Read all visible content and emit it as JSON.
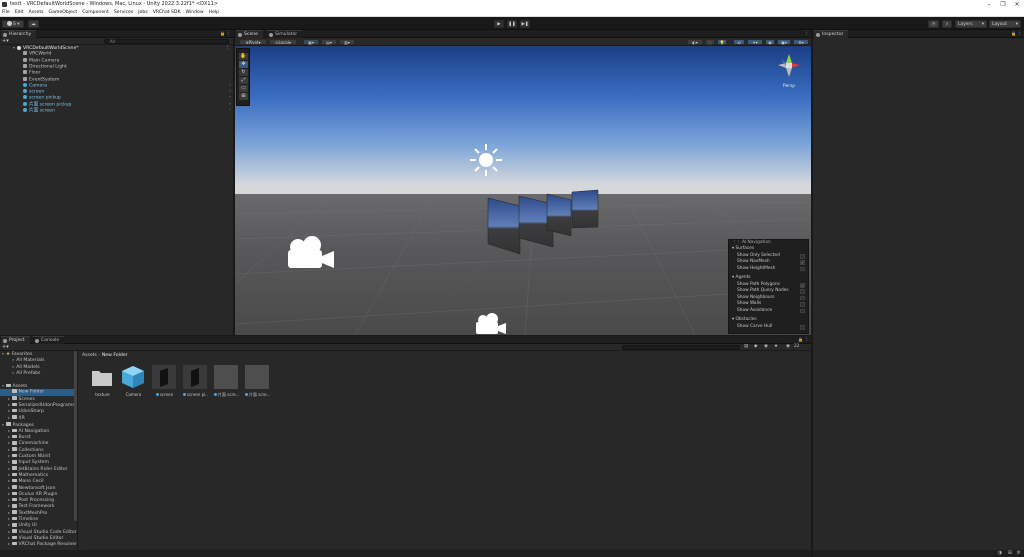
{
  "window": {
    "title": "testt - VRCDefaultWorldScene - Windows, Mac, Linux - Unity 2022.3.22f1* <DX11>",
    "controls": [
      "–",
      "❐",
      "✕"
    ]
  },
  "menu": [
    "File",
    "Edit",
    "Assets",
    "GameObject",
    "Component",
    "Services",
    "Jobs",
    "VRChat SDK",
    "Window",
    "Help"
  ],
  "toolbar": {
    "account_initial": "S",
    "play": "▶",
    "pause": "❚❚",
    "step": "▶❚",
    "layers_label": "Layers",
    "layout_label": "Layout"
  },
  "hierarchy": {
    "tab_label": "Hierarchy",
    "search_placeholder": "All",
    "scene_name": "VRCDefaultWorldScene*",
    "items": [
      {
        "label": "VRCWorld",
        "kind": "gray"
      },
      {
        "label": "Main Camera",
        "kind": "gray"
      },
      {
        "label": "Directional Light",
        "kind": "gray"
      },
      {
        "label": "Floor",
        "kind": "gray"
      },
      {
        "label": "EventSystem",
        "kind": "gray"
      },
      {
        "label": "Camera",
        "kind": "cyan"
      },
      {
        "label": "screen",
        "kind": "cyan"
      },
      {
        "label": "screen pickup",
        "kind": "cyan"
      },
      {
        "label": "片面 screen pickup",
        "kind": "cyan"
      },
      {
        "label": "片面 screen",
        "kind": "cyan"
      }
    ]
  },
  "scene": {
    "tabs": [
      "Scene",
      "Simulator"
    ],
    "pivot_label": "Pivot",
    "local_label": "Local",
    "view_label": "Persp",
    "tools": [
      "hand",
      "move",
      "rotate",
      "scale",
      "rect",
      "transform"
    ]
  },
  "navigation_overlay": {
    "title": "AI Navigation",
    "surfaces_header": "Surfaces",
    "surfaces": [
      {
        "label": "Show Only Selected",
        "checked": false
      },
      {
        "label": "Show NavMesh",
        "checked": true
      },
      {
        "label": "Show HeightMesh",
        "checked": false
      }
    ],
    "agents_header": "Agents",
    "agents": [
      {
        "label": "Show Path Polygons",
        "checked": true
      },
      {
        "label": "Show Path Query Nodes",
        "checked": false
      },
      {
        "label": "Show Neighbours",
        "checked": false
      },
      {
        "label": "Show Walls",
        "checked": false
      },
      {
        "label": "Show Avoidance",
        "checked": false
      }
    ],
    "obstacles_header": "Obstacles",
    "obstacles": [
      {
        "label": "Show Carve Hull",
        "checked": false
      }
    ]
  },
  "inspector": {
    "tab_label": "Inspector"
  },
  "project": {
    "tabs": [
      "Project",
      "Console"
    ],
    "favorites_label": "Favorites",
    "favorites": [
      "All Materials",
      "All Models",
      "All Prefabs"
    ],
    "assets_label": "Assets",
    "asset_folders": [
      "New Folder",
      "Scenes",
      "SerializedUdonPrograms",
      "UdonSharp",
      "XR"
    ],
    "packages_label": "Packages",
    "packages": [
      "AI Navigation",
      "Burst",
      "Cinemachine",
      "Collections",
      "Custom NUnit",
      "Input System",
      "JetBrains Rider Editor",
      "Mathematics",
      "Mono Cecil",
      "Newtonsoft Json",
      "Oculus XR Plugin",
      "Post Processing",
      "Test Framework",
      "TextMeshPro",
      "Timeline",
      "Unity UI",
      "Visual Studio Code Editor",
      "Visual Studio Editor",
      "VRChat Package Resolver"
    ],
    "breadcrumb": [
      "Assets",
      "New Folder"
    ],
    "hidden_count": "22",
    "assets": [
      {
        "label": "texture",
        "thumb": "folder"
      },
      {
        "label": "Camera",
        "thumb": "prefab"
      },
      {
        "label": "screen",
        "thumb": "dark"
      },
      {
        "label": "screen pi...",
        "thumb": "dark"
      },
      {
        "label": "片面 scre...",
        "thumb": "gray"
      },
      {
        "label": "片面 scre...",
        "thumb": "gray"
      }
    ]
  },
  "colors": {
    "accent_selection": "#2c5d87",
    "prefab_blue": "#4aa8d8"
  }
}
